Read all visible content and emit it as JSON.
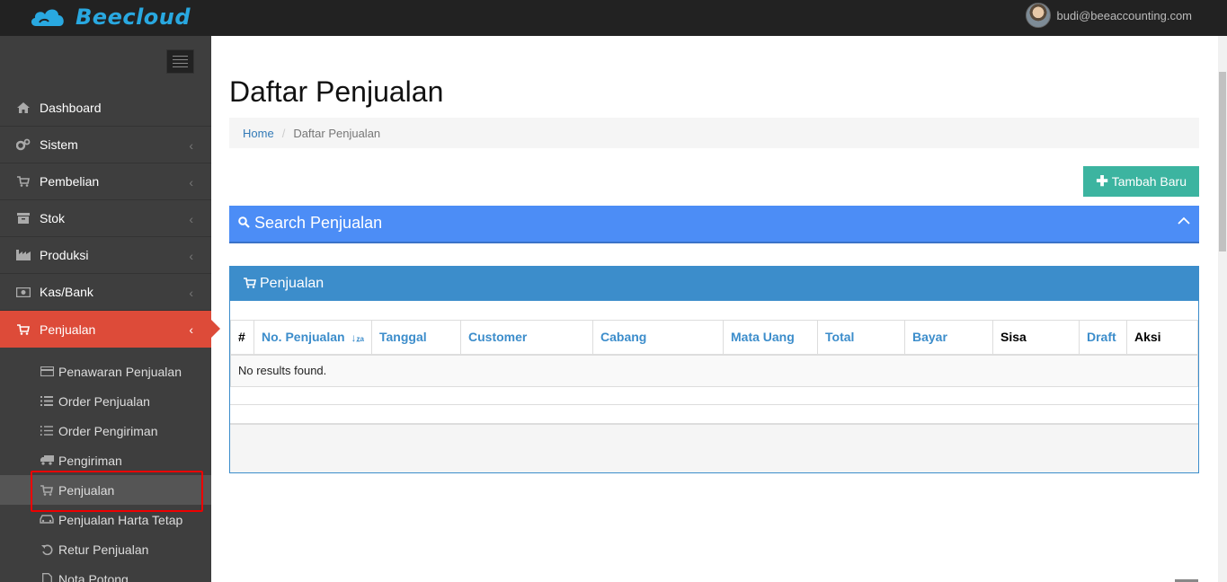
{
  "topbar": {
    "brand": "Beecloud",
    "brand_color": "#29a8e0",
    "user_email": "budi@beeaccounting.com"
  },
  "sidebar": {
    "active_color": "#dd4b39",
    "items": [
      {
        "label": "Dashboard",
        "icon": "home-icon"
      },
      {
        "label": "Sistem",
        "icon": "gears-icon"
      },
      {
        "label": "Pembelian",
        "icon": "cart-icon"
      },
      {
        "label": "Stok",
        "icon": "archive-icon"
      },
      {
        "label": "Produksi",
        "icon": "factory-icon"
      },
      {
        "label": "Kas/Bank",
        "icon": "money-icon"
      },
      {
        "label": "Penjualan",
        "icon": "cart-icon"
      }
    ],
    "submenu": [
      {
        "label": "Penawaran Penjualan",
        "icon": "credit-card-icon"
      },
      {
        "label": "Order Penjualan",
        "icon": "list-icon"
      },
      {
        "label": "Order Pengiriman",
        "icon": "ordered-list-icon"
      },
      {
        "label": "Pengiriman",
        "icon": "truck-icon"
      },
      {
        "label": "Penjualan",
        "icon": "cart-icon"
      },
      {
        "label": "Penjualan Harta Tetap",
        "icon": "car-icon"
      },
      {
        "label": "Retur Penjualan",
        "icon": "undo-icon"
      },
      {
        "label": "Nota Potong",
        "icon": "file-icon"
      }
    ]
  },
  "main": {
    "title": "Daftar Penjualan",
    "breadcrumb": {
      "home": "Home",
      "separator": "/",
      "current": "Daftar Penjualan"
    },
    "add_button": "Tambah Baru",
    "add_color": "#3cb4a0",
    "search_title": "Search Penjualan",
    "search_color": "#4c8df6",
    "table_title": "Penjualan",
    "table_color": "#3c8dcb",
    "columns": [
      "#",
      "No. Penjualan",
      "Tanggal",
      "Customer",
      "Cabang",
      "Mata Uang",
      "Total",
      "Bayar",
      "Sisa",
      "Draft",
      "Aksi"
    ],
    "empty_text": "No results found."
  }
}
